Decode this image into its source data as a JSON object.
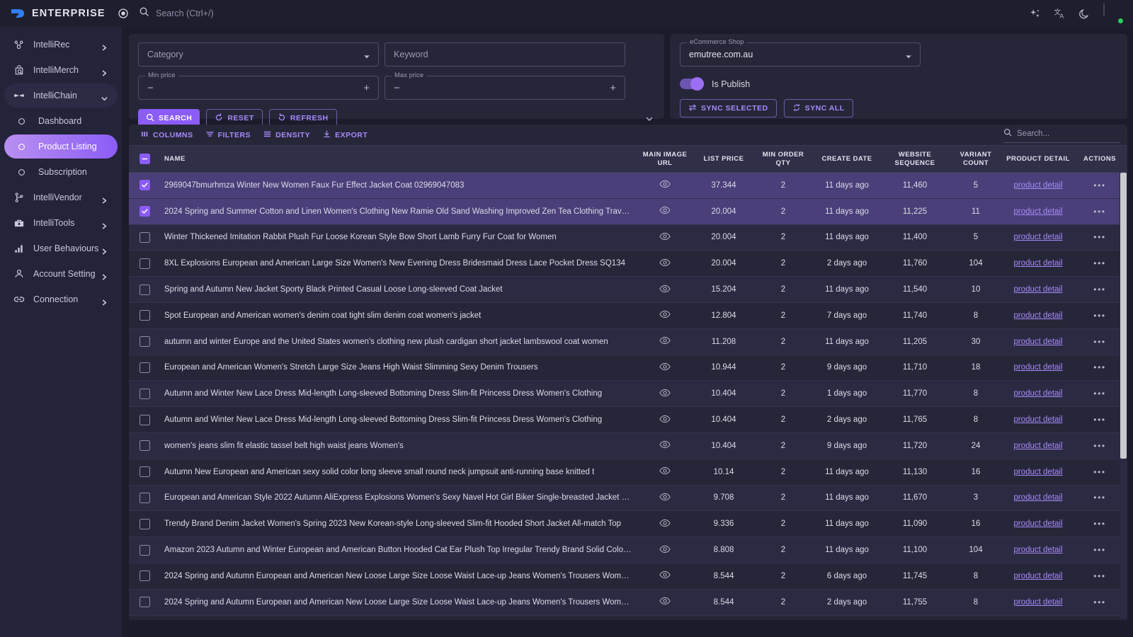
{
  "topbar": {
    "brand_name": "ENTERPRISE",
    "search_placeholder": "Search (Ctrl+/)",
    "icons": [
      "sparkles-icon",
      "translate-icon",
      "dark-mode-icon"
    ]
  },
  "sidebar": {
    "items": [
      {
        "label": "IntelliRec",
        "icon": "network-nodes-icon",
        "state": "collapsed",
        "level": "top"
      },
      {
        "label": "IntelliMerch",
        "icon": "bag-search-icon",
        "state": "collapsed",
        "level": "top"
      },
      {
        "label": "IntelliChain",
        "icon": "chain-link-icon",
        "state": "expanded",
        "level": "top"
      },
      {
        "label": "Dashboard",
        "icon": "circle-icon",
        "state": "none",
        "level": "child"
      },
      {
        "label": "Product Listing",
        "icon": "circle-icon",
        "state": "active",
        "level": "child"
      },
      {
        "label": "Subscription",
        "icon": "circle-icon",
        "state": "none",
        "level": "child"
      },
      {
        "label": "IntelliVendor",
        "icon": "branch-icon",
        "state": "collapsed",
        "level": "top"
      },
      {
        "label": "IntelliTools",
        "icon": "toolbox-icon",
        "state": "collapsed",
        "level": "top"
      },
      {
        "label": "User Behaviours",
        "icon": "bar-chart-icon",
        "state": "collapsed",
        "level": "top"
      },
      {
        "label": "Account Setting",
        "icon": "person-icon",
        "state": "collapsed",
        "level": "top"
      },
      {
        "label": "Connection",
        "icon": "link-icon",
        "state": "collapsed",
        "level": "top"
      }
    ]
  },
  "filters": {
    "category": {
      "placeholder": "Category",
      "value": ""
    },
    "keyword": {
      "placeholder": "Keyword",
      "value": ""
    },
    "min_price": {
      "legend": "Min price",
      "value": ""
    },
    "max_price": {
      "legend": "Max price",
      "value": ""
    },
    "buttons": {
      "search": "SEARCH",
      "reset": "RESET",
      "refresh": "REFRESH"
    }
  },
  "shop_panel": {
    "shop_legend": "eCommerce Shop",
    "shop_value": "emutree.com.au",
    "publish_label": "Is Publish",
    "publish_on": true,
    "sync_selected": "SYNC SELECTED",
    "sync_all": "SYNC ALL"
  },
  "table_toolbar": {
    "columns": "COLUMNS",
    "filters": "FILTERS",
    "density": "DENSITY",
    "export": "EXPORT",
    "search_placeholder": "Search..."
  },
  "table": {
    "headers": {
      "name": "NAME",
      "main_image_url": "MAIN IMAGE URL",
      "list_price": "LIST PRICE",
      "min_order_qty": "MIN ORDER QTY",
      "create_date": "CREATE DATE",
      "website_sequence": "WEBSITE SEQUENCE",
      "variant_count": "VARIANT COUNT",
      "product_detail": "PRODUCT DETAIL",
      "actions": "ACTIONS"
    },
    "product_detail_link": "product detail",
    "header_checkbox_state": "indeterminate",
    "rows": [
      {
        "selected": true,
        "name": "2969047bmurhmza Winter New Women Faux Fur Effect Jacket Coat 02969047083",
        "list_price": "37.344",
        "min_order_qty": "2",
        "create_date": "11 days ago",
        "website_sequence": "11,460",
        "variant_count": "5"
      },
      {
        "selected": true,
        "name": "2024 Spring and Summer Cotton and Linen Women's Clothing New Ramie Old Sand Washing Improved Zen Tea Clothing Travel ...",
        "list_price": "20.004",
        "min_order_qty": "2",
        "create_date": "11 days ago",
        "website_sequence": "11,225",
        "variant_count": "11"
      },
      {
        "selected": false,
        "name": "Winter Thickened Imitation Rabbit Plush Fur Loose Korean Style Bow Short Lamb Furry Fur Coat for Women",
        "list_price": "20.004",
        "min_order_qty": "2",
        "create_date": "11 days ago",
        "website_sequence": "11,400",
        "variant_count": "5"
      },
      {
        "selected": false,
        "name": "8XL Explosions European and American Large Size Women's New Evening Dress Bridesmaid Dress Lace Pocket Dress SQ134",
        "list_price": "20.004",
        "min_order_qty": "2",
        "create_date": "2 days ago",
        "website_sequence": "11,760",
        "variant_count": "104"
      },
      {
        "selected": false,
        "name": "Spring and Autumn New Jacket Sporty Black Printed Casual Loose Long-sleeved Coat Jacket",
        "list_price": "15.204",
        "min_order_qty": "2",
        "create_date": "11 days ago",
        "website_sequence": "11,540",
        "variant_count": "10"
      },
      {
        "selected": false,
        "name": "Spot European and American women's denim coat tight slim denim coat women's jacket",
        "list_price": "12.804",
        "min_order_qty": "2",
        "create_date": "7 days ago",
        "website_sequence": "11,740",
        "variant_count": "8"
      },
      {
        "selected": false,
        "name": "autumn and winter Europe and the United States women's clothing new plush cardigan short jacket lambswool coat women",
        "list_price": "11.208",
        "min_order_qty": "2",
        "create_date": "11 days ago",
        "website_sequence": "11,205",
        "variant_count": "30"
      },
      {
        "selected": false,
        "name": "European and American Women's Stretch Large Size Jeans High Waist Slimming Sexy Denim Trousers",
        "list_price": "10.944",
        "min_order_qty": "2",
        "create_date": "9 days ago",
        "website_sequence": "11,710",
        "variant_count": "18"
      },
      {
        "selected": false,
        "name": "Autumn and Winter New Lace Dress Mid-length Long-sleeved Bottoming Dress Slim-fit Princess Dress Women's Clothing",
        "list_price": "10.404",
        "min_order_qty": "2",
        "create_date": "1 days ago",
        "website_sequence": "11,770",
        "variant_count": "8"
      },
      {
        "selected": false,
        "name": "Autumn and Winter New Lace Dress Mid-length Long-sleeved Bottoming Dress Slim-fit Princess Dress Women's Clothing",
        "list_price": "10.404",
        "min_order_qty": "2",
        "create_date": "2 days ago",
        "website_sequence": "11,765",
        "variant_count": "8"
      },
      {
        "selected": false,
        "name": "women's jeans slim fit elastic tassel belt high waist jeans Women's",
        "list_price": "10.404",
        "min_order_qty": "2",
        "create_date": "9 days ago",
        "website_sequence": "11,720",
        "variant_count": "24"
      },
      {
        "selected": false,
        "name": "Autumn New European and American sexy solid color long sleeve small round neck jumpsuit anti-running base knitted t",
        "list_price": "10.14",
        "min_order_qty": "2",
        "create_date": "11 days ago",
        "website_sequence": "11,130",
        "variant_count": "16"
      },
      {
        "selected": false,
        "name": "European and American Style 2022 Autumn AliExpress Explosions Women's Sexy Navel Hot Girl Biker Single-breasted Jacket Coat",
        "list_price": "9.708",
        "min_order_qty": "2",
        "create_date": "11 days ago",
        "website_sequence": "11,670",
        "variant_count": "3"
      },
      {
        "selected": false,
        "name": "Trendy Brand Denim Jacket Women's Spring 2023 New Korean-style Long-sleeved Slim-fit Hooded Short Jacket All-match Top",
        "list_price": "9.336",
        "min_order_qty": "2",
        "create_date": "11 days ago",
        "website_sequence": "11,090",
        "variant_count": "16"
      },
      {
        "selected": false,
        "name": "Amazon 2023 Autumn and Winter European and American Button Hooded Cat Ear Plush Top Irregular Trendy Brand Solid Color J...",
        "list_price": "8.808",
        "min_order_qty": "2",
        "create_date": "11 days ago",
        "website_sequence": "11,100",
        "variant_count": "104"
      },
      {
        "selected": false,
        "name": "2024 Spring and Autumn European and American New Loose Large Size Loose Waist Lace-up Jeans Women's Trousers Women'...",
        "list_price": "8.544",
        "min_order_qty": "2",
        "create_date": "6 days ago",
        "website_sequence": "11,745",
        "variant_count": "8"
      },
      {
        "selected": false,
        "name": "2024 Spring and Autumn European and American New Loose Large Size Loose Waist Lace-up Jeans Women's Trousers Women'...",
        "list_price": "8.544",
        "min_order_qty": "2",
        "create_date": "2 days ago",
        "website_sequence": "11,755",
        "variant_count": "8"
      }
    ]
  },
  "colors": {
    "accent": "#8b5cf6",
    "accent_light": "#a78bfa",
    "selected_row": "#4a3f78",
    "panel_bg": "#262639",
    "page_bg": "#1b1b2b",
    "sidebar_bg": "#23233a",
    "online": "#2ecc5a"
  }
}
